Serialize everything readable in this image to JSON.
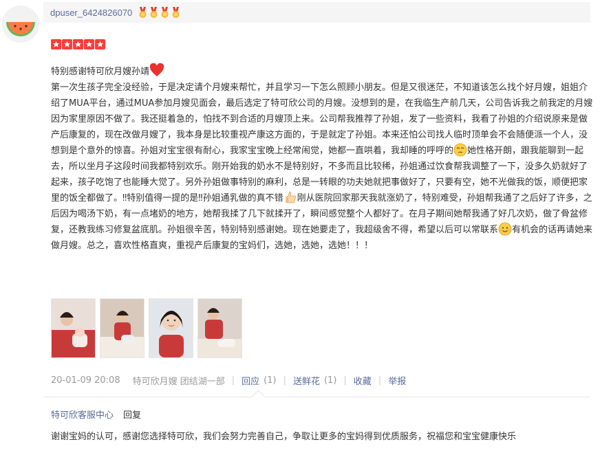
{
  "user": {
    "name": "dpuser_6424826070",
    "avatar_icon": "watermelon-icon",
    "medal_icon": "medal-icon",
    "medal_count": 4
  },
  "rating": {
    "stars": 5,
    "max": 5,
    "color": "#ff3b3b"
  },
  "review": {
    "title": "特别感谢特可欣月嫂孙靖",
    "segments": [
      "第一次生孩子完全没经验，于是决定请个月嫂来帮忙，并且学习一下怎么照顾小朋友。但是又很迷茫，不知道该怎么找个好月嫂，姐姐介绍了MUA平台，通过MUA参加月嫂见面会，最后选定了特可欣公司的月嫂。没想到的是，在我临生产前几天，公司告诉我之前我定的月嫂因为家里原因不做了。我还挺着急的，怕找不到合适的月嫂顶上来。公司帮我推荐了孙姐，发了一些资料，我看了孙姐的介绍说原来是做产后康复的，现在改做月嫂了，我本身是比较重视产康这方面的，于是就定了孙姐。本来还怕公司找人临时顶单会不会随便派一个人，没想到是个意外的惊喜。孙姐对宝宝很有耐心，我家宝宝晚上经常闹觉，她都一直哄着，我却睡的呼呼的",
      "她性格开朗，跟我能聊到一起去，所以坐月子这段时间我都特别欢乐。刚开始我的奶水不是特别好，不多而且比较稀，孙姐通过饮食帮我调整了一下，没多久奶就好了起来，孩子吃饱了也能睡大觉了。另外孙姐做事特别的麻利，总是一转眼的功夫她就把事做好了，只要有空，她不光做我的饭，顺便把家里的饭全都做了。‼特别值得一提的是‼孙姐通乳做的真不错",
      "刚从医院回家那天我就涨奶了，特别难受，孙姐帮我通了之后好了许多，之后因为喝汤下奶，有一点堵奶的地方，她帮我揉了几下就揉开了，瞬间感觉整个人都好了。在月子期间她帮我通了好几次奶，做了骨盆修复，还教我练习修复盆底肌。孙姐很辛苦，特别特别感谢她。现在她要走了，我超级舍不得，希望以后可以常联系",
      "有机会的话再请她来做月嫂。总之，喜欢性格直爽，重视产后康复的宝妈们，选她，选她，选她！！！"
    ],
    "inline_icons": [
      "heart-icon",
      "sleepy-face-icon",
      "thumbs-up-icon",
      "smiling-face-icon"
    ],
    "photo_count": 4
  },
  "meta": {
    "datetime": "20-01-09 20:08",
    "shop_branch": "特可欣月嫂 团结湖一部",
    "reply_label": "回应",
    "reply_count": "(1)",
    "flower_label": "送鲜花",
    "flower_count": "(1)",
    "favorite_label": "收藏",
    "report_label": "举报"
  },
  "shop_reply": {
    "shop_name": "特可欣客服中心",
    "tag": "回复",
    "text": "谢谢宝妈的认可，感谢您选择特可欣，我们会努力完善自己，争取让更多的宝妈得到优质服务，祝福您和宝宝健康快乐"
  },
  "colors": {
    "link": "#5a6a9a",
    "muted": "#999999",
    "header_bg": "#f5f5f5"
  }
}
